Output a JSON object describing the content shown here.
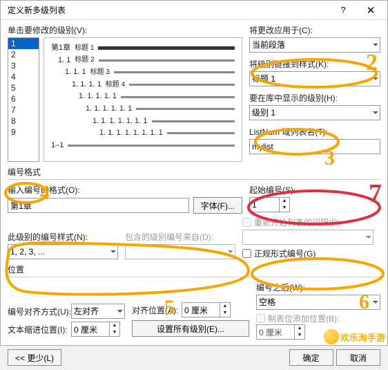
{
  "title": "定义新多级列表",
  "help_icon": "?",
  "close_icon": "✕",
  "labels": {
    "click_level": "单击要修改的级别(V):",
    "apply_to": "将更改应用于(C):",
    "apply_to_value": "当前段落",
    "link_style": "将级别链接到样式(K):",
    "link_style_value": "标题 1",
    "show_in_gallery": "要在库中显示的级别(H):",
    "show_in_gallery_value": "级别 1",
    "listnum": "ListNum 域列表名(T):",
    "listnum_value": "mylist",
    "number_format_section": "编号格式",
    "enter_format": "输入编号的格式(O):",
    "enter_format_value": "第1章",
    "font_btn": "字体(F)...",
    "start_at": "起始编号(S):",
    "start_at_value": "1",
    "number_style": "此级别的编号样式(N):",
    "number_style_value": "1, 2, 3, ...",
    "include_from": "包含的级别编号来自(D):",
    "restart_after": "重新开始列表的间隔(R):",
    "legal_format": "正规形式编号(G)",
    "position_section": "位置",
    "align": "编号对齐方式(U):",
    "align_value": "左对齐",
    "align_at": "对齐位置(A):",
    "align_at_value": "0 厘米",
    "follow": "编号之后(W):",
    "follow_value": "空格",
    "indent": "文本缩进位置(I):",
    "indent_value": "0 厘米",
    "set_all": "设置所有级别(E)...",
    "tab_stop": "制表位添加位置(B):",
    "tab_stop_value": "0 厘米",
    "less": "<< 更少(L)",
    "ok": "确定",
    "cancel": "取消"
  },
  "levels": [
    "1",
    "2",
    "3",
    "4",
    "5",
    "6",
    "7",
    "8",
    "9"
  ],
  "preview_lines": [
    {
      "pad": 0,
      "txt": "第1章",
      "lbl": "标题 1",
      "thick": true
    },
    {
      "pad": 10,
      "txt": "1. 1",
      "lbl": "标题 2"
    },
    {
      "pad": 20,
      "txt": "1. 1. 1",
      "lbl": "标题 3"
    },
    {
      "pad": 30,
      "txt": "1. 1. 1. 1",
      "lbl": "标题 4"
    },
    {
      "pad": 40,
      "txt": "1. 1. 1. 1. 1"
    },
    {
      "pad": 50,
      "txt": "1. 1. 1. 1. 1. 1"
    },
    {
      "pad": 60,
      "txt": "1. 1. 1. 1. 1. 1. 1"
    },
    {
      "pad": 70,
      "txt": "1. 1. 1. 1. 1. 1. 1. 1"
    },
    {
      "pad": 0,
      "txt": "1–1"
    }
  ],
  "watermark": "欢乐淘手游",
  "annotations": {
    "n2": "2",
    "n3": "3",
    "n4": "4",
    "n5": "5",
    "n6": "6",
    "n7": "7"
  }
}
